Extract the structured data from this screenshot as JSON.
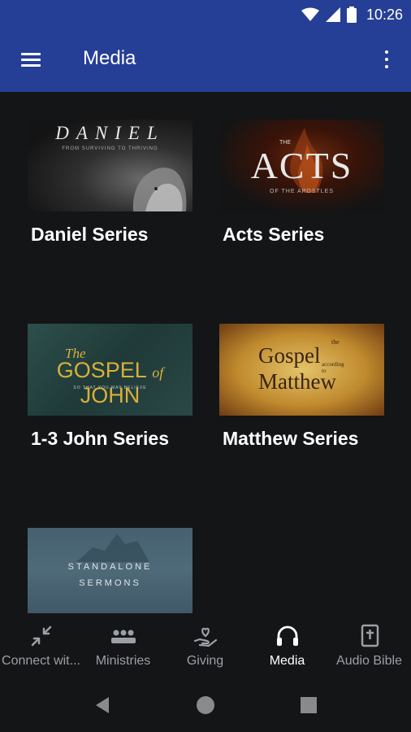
{
  "status_bar": {
    "time": "10:26"
  },
  "app_bar": {
    "title": "Media"
  },
  "media_items": [
    {
      "label": "Daniel Series",
      "thumb_title": "DANIEL",
      "thumb_subtitle": "FROM SURVIVING TO THRIVING"
    },
    {
      "label": "Acts Series",
      "thumb_small": "THE",
      "thumb_title": "ACTS",
      "thumb_subtitle": "OF THE APOSTLES"
    },
    {
      "label": "1-3 John Series",
      "thumb_the": "The",
      "thumb_gospel": "GOSPEL",
      "thumb_of": "of",
      "thumb_john": "JOHN",
      "thumb_subtitle": "SO THAT YOU MAY BELIEVE"
    },
    {
      "label": "Matthew Series",
      "thumb_the": "the",
      "thumb_gospel": "Gospel",
      "thumb_according": "according to",
      "thumb_name": "Matthew"
    },
    {
      "label": "",
      "thumb_line1": "STANDALONE",
      "thumb_line2": "SERMONS"
    }
  ],
  "bottom_nav": [
    {
      "label": "Connect wit...",
      "icon": "arrows-in-icon"
    },
    {
      "label": "Ministries",
      "icon": "group-icon"
    },
    {
      "label": "Giving",
      "icon": "hand-heart-icon"
    },
    {
      "label": "Media",
      "icon": "headphones-icon",
      "active": true
    },
    {
      "label": "Audio Bible",
      "icon": "bible-icon"
    }
  ],
  "colors": {
    "app_bar": "#253f96",
    "background": "#141517",
    "nav_inactive": "#9aa0a6",
    "nav_active": "#ffffff"
  }
}
